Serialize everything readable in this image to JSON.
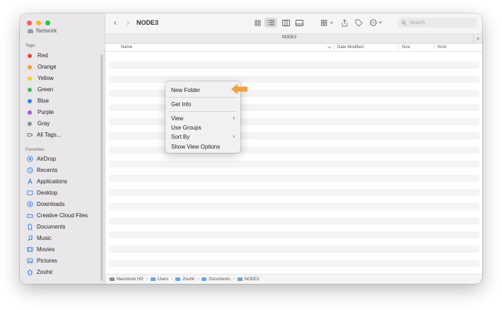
{
  "window": {
    "title": "NODE3",
    "tab_title": "NODE3",
    "tab_add": "+"
  },
  "toolbar": {
    "back": "‹",
    "forward": "›",
    "search_placeholder": "Search"
  },
  "sidebar": {
    "network_label": "Network",
    "tags_header": "Tags",
    "tags": [
      {
        "label": "Red",
        "color": "#f23c3c"
      },
      {
        "label": "Orange",
        "color": "#f59a2b"
      },
      {
        "label": "Yellow",
        "color": "#f5cf2b"
      },
      {
        "label": "Green",
        "color": "#35c24a"
      },
      {
        "label": "Blue",
        "color": "#2f7ef1"
      },
      {
        "label": "Purple",
        "color": "#a656d9"
      },
      {
        "label": "Gray",
        "color": "#8e8e93"
      },
      {
        "label": "All Tags..."
      }
    ],
    "favorites_header": "Favorites",
    "favorites": [
      {
        "label": "AirDrop",
        "icon": "airdrop-icon"
      },
      {
        "label": "Recents",
        "icon": "clock-icon"
      },
      {
        "label": "Applications",
        "icon": "applications-icon"
      },
      {
        "label": "Desktop",
        "icon": "desktop-icon"
      },
      {
        "label": "Downloads",
        "icon": "download-icon"
      },
      {
        "label": "Creative Cloud Files",
        "icon": "folder-icon"
      },
      {
        "label": "Documents",
        "icon": "document-icon"
      },
      {
        "label": "Music",
        "icon": "music-icon"
      },
      {
        "label": "Movies",
        "icon": "movie-icon"
      },
      {
        "label": "Pictures",
        "icon": "pictures-icon"
      },
      {
        "label": "Zouhir",
        "icon": "home-icon"
      }
    ],
    "accent": "#2f7ef1"
  },
  "columns": {
    "name": "Name",
    "date_modified": "Date Modified",
    "size": "Size",
    "kind": "Kind"
  },
  "pathbar": {
    "crumbs": [
      "Macintosh HD",
      "Users",
      "Zouhir",
      "Documents",
      "NODE3"
    ]
  },
  "context_menu": {
    "new_folder": "New Folder",
    "get_info": "Get Info",
    "view": "View",
    "use_groups": "Use Groups",
    "sort_by": "Sort By",
    "show_view_options": "Show View Options",
    "submenu_chevron": "›"
  },
  "annotation": {
    "arrow_color": "#f0a043"
  }
}
